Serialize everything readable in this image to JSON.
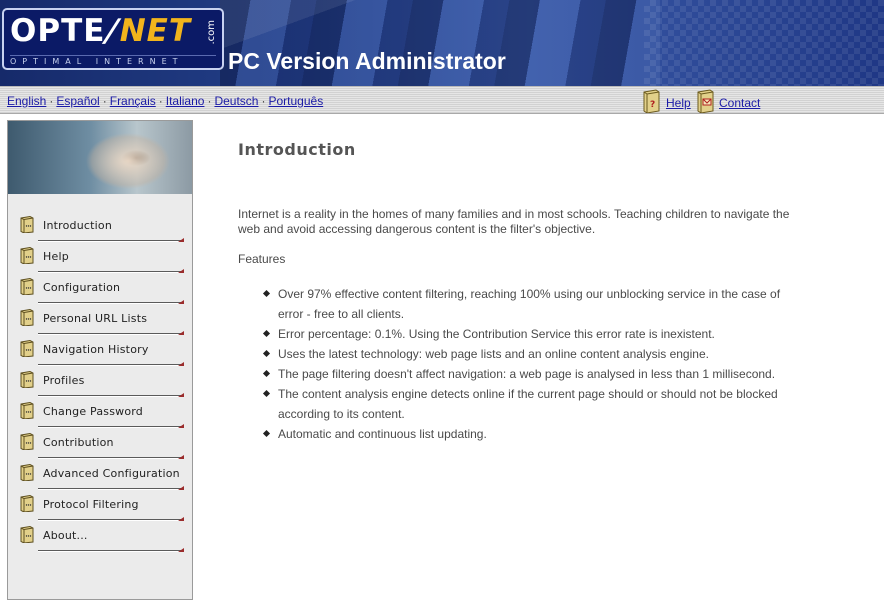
{
  "header": {
    "logo_text_left": "OPTE",
    "logo_text_right": "NET",
    "logo_dotcom": ".com",
    "logo_tagline": "OPTIMAL INTERNET",
    "app_title": "PC Version Administrator"
  },
  "langbar": {
    "languages": [
      "English",
      "Español",
      "Français",
      "Italiano",
      "Deutsch",
      "Português"
    ],
    "help_label": "Help",
    "contact_label": "Contact"
  },
  "sidebar": {
    "items": [
      {
        "label": "Introduction"
      },
      {
        "label": "Help"
      },
      {
        "label": "Configuration"
      },
      {
        "label": "Personal URL Lists"
      },
      {
        "label": "Navigation History"
      },
      {
        "label": "Profiles"
      },
      {
        "label": "Change Password"
      },
      {
        "label": "Contribution"
      },
      {
        "label": "Advanced Configuration"
      },
      {
        "label": "Protocol Filtering"
      },
      {
        "label": "About..."
      }
    ]
  },
  "main": {
    "title": "Introduction",
    "intro": "Internet is a reality in the homes of many families and in most schools. Teaching children to navigate the web and avoid accessing dangerous content is the filter's objective.",
    "features_label": "Features",
    "features": [
      "Over 97% effective content filtering, reaching 100% using our unblocking service in the case of error - free to all clients.",
      "Error percentage: 0.1%. Using the Contribution Service this error rate is inexistent.",
      "Uses the latest technology: web page lists and an online content analysis engine.",
      "The page filtering doesn't affect navigation: a web page is analysed in less than 1 millisecond.",
      "The content analysis engine detects online if the current page should or should not be blocked according to its content.",
      "Automatic and continuous list updating."
    ]
  },
  "colors": {
    "banner": "#23408a",
    "logo_accent": "#f2b41c",
    "link": "#1a1aa6"
  }
}
